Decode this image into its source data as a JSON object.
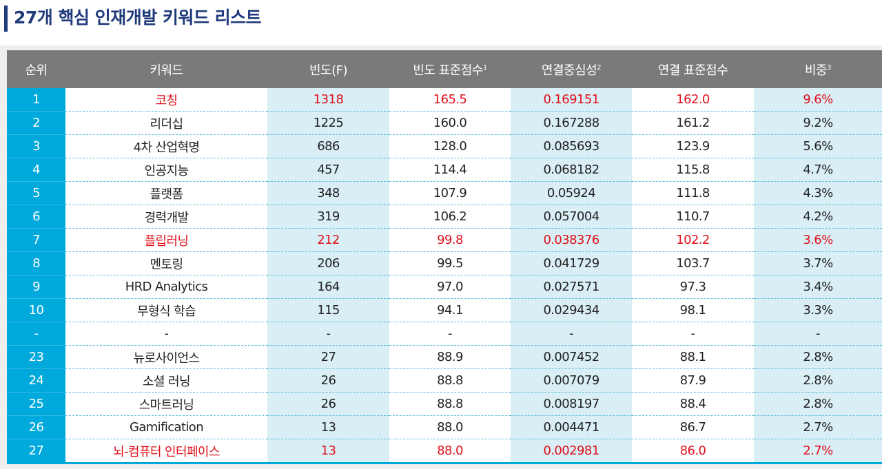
{
  "title": "27개 핵심 인재개발 키워드 리스트",
  "colors": {
    "accent": "#00a9dc",
    "header": "#7a7a7a",
    "highlight": "#e0101a",
    "title": "#1f3a7a"
  },
  "headers": [
    {
      "text": "순위",
      "sup": ""
    },
    {
      "text": "키워드",
      "sup": ""
    },
    {
      "text": "빈도(F)",
      "sup": ""
    },
    {
      "text": "빈도 표준점수",
      "sup": "1"
    },
    {
      "text": "연결중심성",
      "sup": "2"
    },
    {
      "text": "연결 표준점수",
      "sup": ""
    },
    {
      "text": "비중",
      "sup": "3"
    }
  ],
  "rows": [
    {
      "rank": "1",
      "keyword": "코칭",
      "freq": "1318",
      "freq_std": "165.5",
      "centrality": "0.169151",
      "conn_std": "162.0",
      "share": "9.6%",
      "highlight": true
    },
    {
      "rank": "2",
      "keyword": "리더십",
      "freq": "1225",
      "freq_std": "160.0",
      "centrality": "0.167288",
      "conn_std": "161.2",
      "share": "9.2%",
      "highlight": false
    },
    {
      "rank": "3",
      "keyword": "4차 산업혁명",
      "freq": "686",
      "freq_std": "128.0",
      "centrality": "0.085693",
      "conn_std": "123.9",
      "share": "5.6%",
      "highlight": false
    },
    {
      "rank": "4",
      "keyword": "인공지능",
      "freq": "457",
      "freq_std": "114.4",
      "centrality": "0.068182",
      "conn_std": "115.8",
      "share": "4.7%",
      "highlight": false
    },
    {
      "rank": "5",
      "keyword": "플랫폼",
      "freq": "348",
      "freq_std": "107.9",
      "centrality": "0.05924",
      "conn_std": "111.8",
      "share": "4.3%",
      "highlight": false
    },
    {
      "rank": "6",
      "keyword": "경력개발",
      "freq": "319",
      "freq_std": "106.2",
      "centrality": "0.057004",
      "conn_std": "110.7",
      "share": "4.2%",
      "highlight": false
    },
    {
      "rank": "7",
      "keyword": "플립러닝",
      "freq": "212",
      "freq_std": "99.8",
      "centrality": "0.038376",
      "conn_std": "102.2",
      "share": "3.6%",
      "highlight": true
    },
    {
      "rank": "8",
      "keyword": "멘토링",
      "freq": "206",
      "freq_std": "99.5",
      "centrality": "0.041729",
      "conn_std": "103.7",
      "share": "3.7%",
      "highlight": false
    },
    {
      "rank": "9",
      "keyword": "HRD Analytics",
      "freq": "164",
      "freq_std": "97.0",
      "centrality": "0.027571",
      "conn_std": "97.3",
      "share": "3.4%",
      "highlight": false
    },
    {
      "rank": "10",
      "keyword": "무형식 학습",
      "freq": "115",
      "freq_std": "94.1",
      "centrality": "0.029434",
      "conn_std": "98.1",
      "share": "3.3%",
      "highlight": false
    },
    {
      "rank": "-",
      "keyword": "-",
      "freq": "-",
      "freq_std": "-",
      "centrality": "-",
      "conn_std": "-",
      "share": "-",
      "highlight": false
    },
    {
      "rank": "23",
      "keyword": "뉴로사이언스",
      "freq": "27",
      "freq_std": "88.9",
      "centrality": "0.007452",
      "conn_std": "88.1",
      "share": "2.8%",
      "highlight": false
    },
    {
      "rank": "24",
      "keyword": "소셜 러닝",
      "freq": "26",
      "freq_std": "88.8",
      "centrality": "0.007079",
      "conn_std": "87.9",
      "share": "2.8%",
      "highlight": false
    },
    {
      "rank": "25",
      "keyword": "스마트러닝",
      "freq": "26",
      "freq_std": "88.8",
      "centrality": "0.008197",
      "conn_std": "88.4",
      "share": "2.8%",
      "highlight": false
    },
    {
      "rank": "26",
      "keyword": "Gamification",
      "freq": "13",
      "freq_std": "88.0",
      "centrality": "0.004471",
      "conn_std": "86.7",
      "share": "2.7%",
      "highlight": false
    },
    {
      "rank": "27",
      "keyword": "뇌-컴퓨터 인터페이스",
      "freq": "13",
      "freq_std": "88.0",
      "centrality": "0.002981",
      "conn_std": "86.0",
      "share": "2.7%",
      "highlight": true
    }
  ]
}
